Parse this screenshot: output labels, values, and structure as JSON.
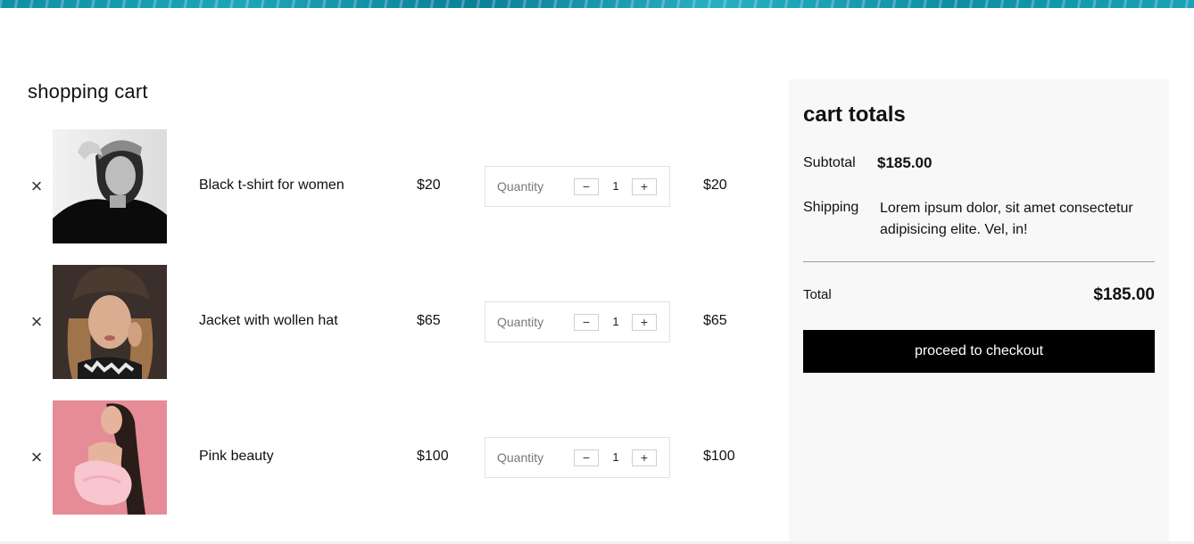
{
  "cart": {
    "title": "shopping cart",
    "remove_icon": "×",
    "quantity_label": "Quantity",
    "minus_label": "−",
    "plus_label": "+",
    "items": [
      {
        "name": "Black t-shirt for women",
        "price": "$20",
        "quantity": "1",
        "total": "$20"
      },
      {
        "name": "Jacket with wollen hat",
        "price": "$65",
        "quantity": "1",
        "total": "$65"
      },
      {
        "name": "Pink beauty",
        "price": "$100",
        "quantity": "1",
        "total": "$100"
      }
    ]
  },
  "totals": {
    "title": "cart totals",
    "subtotal_label": "Subtotal",
    "subtotal_value": "$185.00",
    "shipping_label": "Shipping",
    "shipping_text": "Lorem ipsum dolor, sit amet consectetur adipisicing elite. Vel, in!",
    "total_label": "Total",
    "total_value": "$185.00",
    "checkout_label": "proceed to checkout"
  },
  "colors": {
    "accent_button": "#000000",
    "panel_background": "#f8f8f8",
    "banner": "#1596ad"
  },
  "icons": {
    "remove": "close-icon",
    "decrement": "minus-icon",
    "increment": "plus-icon"
  }
}
